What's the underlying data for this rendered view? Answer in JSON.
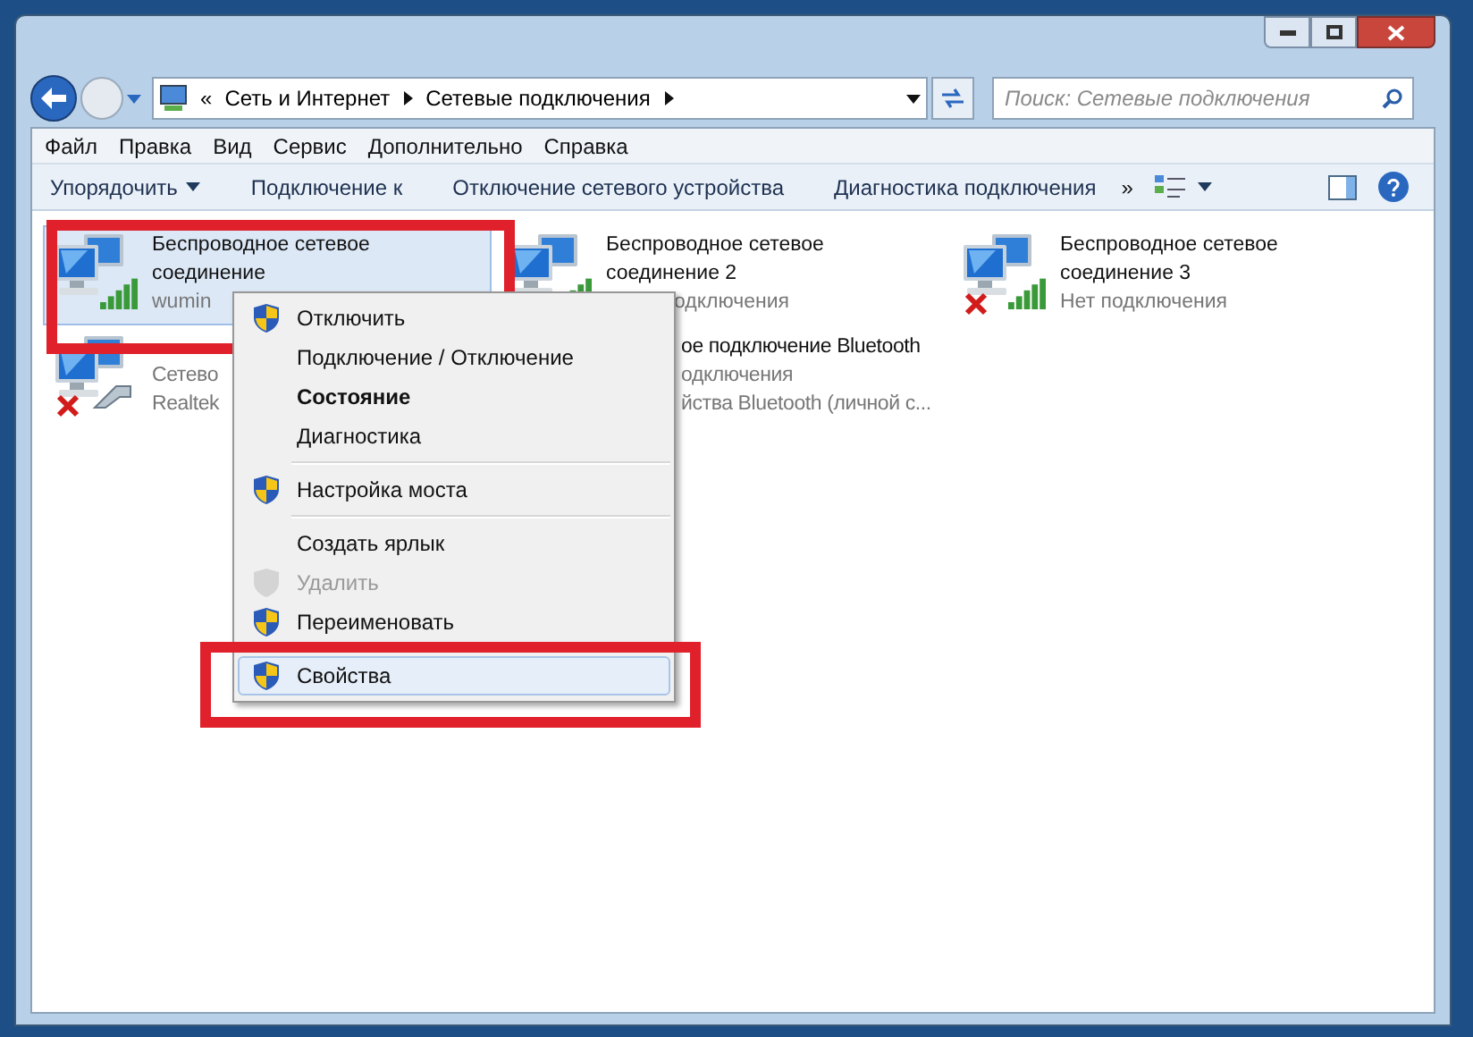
{
  "address_bar": {
    "overflow_mark": "«",
    "crumbs": [
      "Сеть и Интернет",
      "Сетевые подключения"
    ]
  },
  "search": {
    "placeholder": "Поиск: Сетевые подключения"
  },
  "menu_bar": [
    "Файл",
    "Правка",
    "Вид",
    "Сервис",
    "Дополнительно",
    "Справка"
  ],
  "toolbar": {
    "buttons": [
      {
        "label": "Упорядочить",
        "dropdown": true
      },
      {
        "label": "Подключение к",
        "dropdown": false
      },
      {
        "label": "Отключение сетевого устройства",
        "dropdown": false
      },
      {
        "label": "Диагностика подключения",
        "dropdown": false
      }
    ],
    "more": "»"
  },
  "connections": [
    {
      "kind": "wifi",
      "selected": true,
      "lines": [
        "Беспроводное сетевое",
        "соединение",
        "wumin"
      ]
    },
    {
      "kind": "wifi",
      "selected": false,
      "lines": [
        "Беспроводное сетевое",
        "соединение 2"
      ],
      "tail": "одключения"
    },
    {
      "kind": "wifi-off",
      "selected": false,
      "lines": [
        "Беспроводное сетевое",
        "соединение 3",
        "Нет подключения"
      ]
    }
  ],
  "behind_menu": [
    {
      "kind": "cable-off",
      "lines": [
        "Сетево",
        "Realtek"
      ]
    },
    {
      "kind": "none",
      "lines": [
        "ое подключение Bluetooth",
        "одключения",
        "йства Bluetooth (личной с..."
      ]
    }
  ],
  "context_menu": [
    {
      "kind": "item",
      "label": "Отключить",
      "shield": true,
      "bold": false,
      "disabled": false,
      "selected": false
    },
    {
      "kind": "item",
      "label": "Подключение / Отключение",
      "shield": false,
      "bold": false,
      "disabled": false,
      "selected": false
    },
    {
      "kind": "item",
      "label": "Состояние",
      "shield": false,
      "bold": true,
      "disabled": false,
      "selected": false
    },
    {
      "kind": "item",
      "label": "Диагностика",
      "shield": false,
      "bold": false,
      "disabled": false,
      "selected": false
    },
    {
      "kind": "separator"
    },
    {
      "kind": "item",
      "label": "Настройка моста",
      "shield": true,
      "bold": false,
      "disabled": false,
      "selected": false
    },
    {
      "kind": "separator"
    },
    {
      "kind": "item",
      "label": "Создать ярлык",
      "shield": false,
      "bold": false,
      "disabled": false,
      "selected": false
    },
    {
      "kind": "item",
      "label": "Удалить",
      "shield": true,
      "bold": false,
      "disabled": true,
      "selected": false
    },
    {
      "kind": "item",
      "label": "Переименовать",
      "shield": true,
      "bold": false,
      "disabled": false,
      "selected": false
    },
    {
      "kind": "gap"
    },
    {
      "kind": "item",
      "label": "Свойства",
      "shield": true,
      "bold": false,
      "disabled": false,
      "selected": true
    }
  ]
}
